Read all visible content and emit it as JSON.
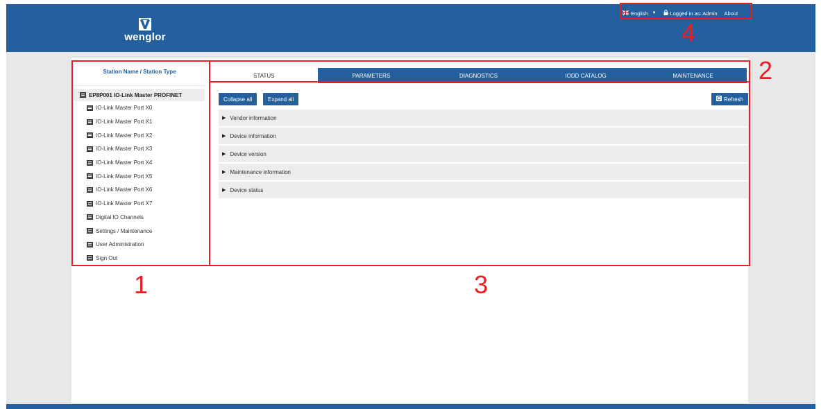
{
  "brand": {
    "logo_text": "wenglor",
    "header_color": "#24609d"
  },
  "topbar": {
    "language": "English",
    "login_status": "Logged in as: Admin",
    "about": "About"
  },
  "sidebar": {
    "title": "Station Name / Station Type",
    "root": "EP8P001 IO-Link Master PROFINET",
    "items": [
      {
        "label": "IO-Link Master Port X0"
      },
      {
        "label": "IO-Link Master Port X1"
      },
      {
        "label": "IO-Link Master Port X2"
      },
      {
        "label": "IO-Link Master Port X3"
      },
      {
        "label": "IO-Link Master Port X4"
      },
      {
        "label": "IO-Link Master Port X5"
      },
      {
        "label": "IO-Link Master Port X6"
      },
      {
        "label": "IO-Link Master Port X7"
      },
      {
        "label": "Digital IO Channels"
      },
      {
        "label": "Settings / Maintenance"
      },
      {
        "label": "User Administration"
      },
      {
        "label": "Sign Out"
      }
    ]
  },
  "tabs": [
    {
      "label": "STATUS",
      "active": true
    },
    {
      "label": "PARAMETERS",
      "active": false
    },
    {
      "label": "DIAGNOSTICS",
      "active": false
    },
    {
      "label": "IODD CATALOG",
      "active": false
    },
    {
      "label": "MAINTENANCE",
      "active": false
    }
  ],
  "toolbar": {
    "collapse_label": "Collapse all",
    "expand_label": "Expand all",
    "refresh_label": "Refresh"
  },
  "sections": [
    {
      "label": "Vendor information"
    },
    {
      "label": "Device information"
    },
    {
      "label": "Device version"
    },
    {
      "label": "Maintenance information"
    },
    {
      "label": "Device status"
    }
  ],
  "annotations": {
    "color": "#ea1d24",
    "one": "1",
    "two": "2",
    "three": "3",
    "four": "4"
  }
}
